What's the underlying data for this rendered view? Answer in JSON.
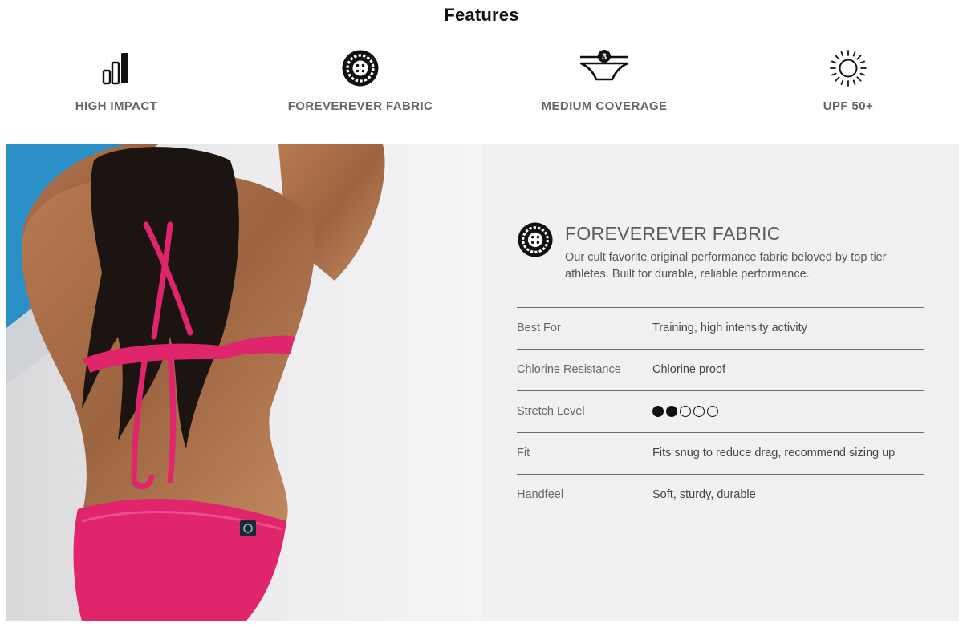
{
  "header": {
    "title": "Features"
  },
  "features": [
    {
      "label": "HIGH IMPACT",
      "icon": "bar-chart-icon"
    },
    {
      "label": "FOREVEREVER FABRIC",
      "icon": "forever-fabric-badge-icon"
    },
    {
      "label": "MEDIUM COVERAGE",
      "icon": "coverage-bottom-icon",
      "badge": "3"
    },
    {
      "label": "UPF 50+",
      "icon": "sun-icon"
    }
  ],
  "fabric": {
    "badge_text": "FOREVER",
    "title": "FOREVEREVER FABRIC",
    "description": "Our cult favorite original performance fabric beloved by top tier athletes. Built for durable, reliable performance."
  },
  "specs": [
    {
      "label": "Best For",
      "value": "Training, high intensity activity"
    },
    {
      "label": "Chlorine Resistance",
      "value": "Chlorine proof"
    },
    {
      "label": "Stretch Level",
      "rating": 2,
      "rating_max": 5
    },
    {
      "label": "Fit",
      "value": "Fits snug to reduce drag, recommend sizing up"
    },
    {
      "label": "Handfeel",
      "value": "Soft, sturdy, durable"
    }
  ],
  "colors": {
    "bikini": "#e0256d",
    "ink": "#111111",
    "panel": "#f1f1f1",
    "pool": "#2a8fc4"
  }
}
